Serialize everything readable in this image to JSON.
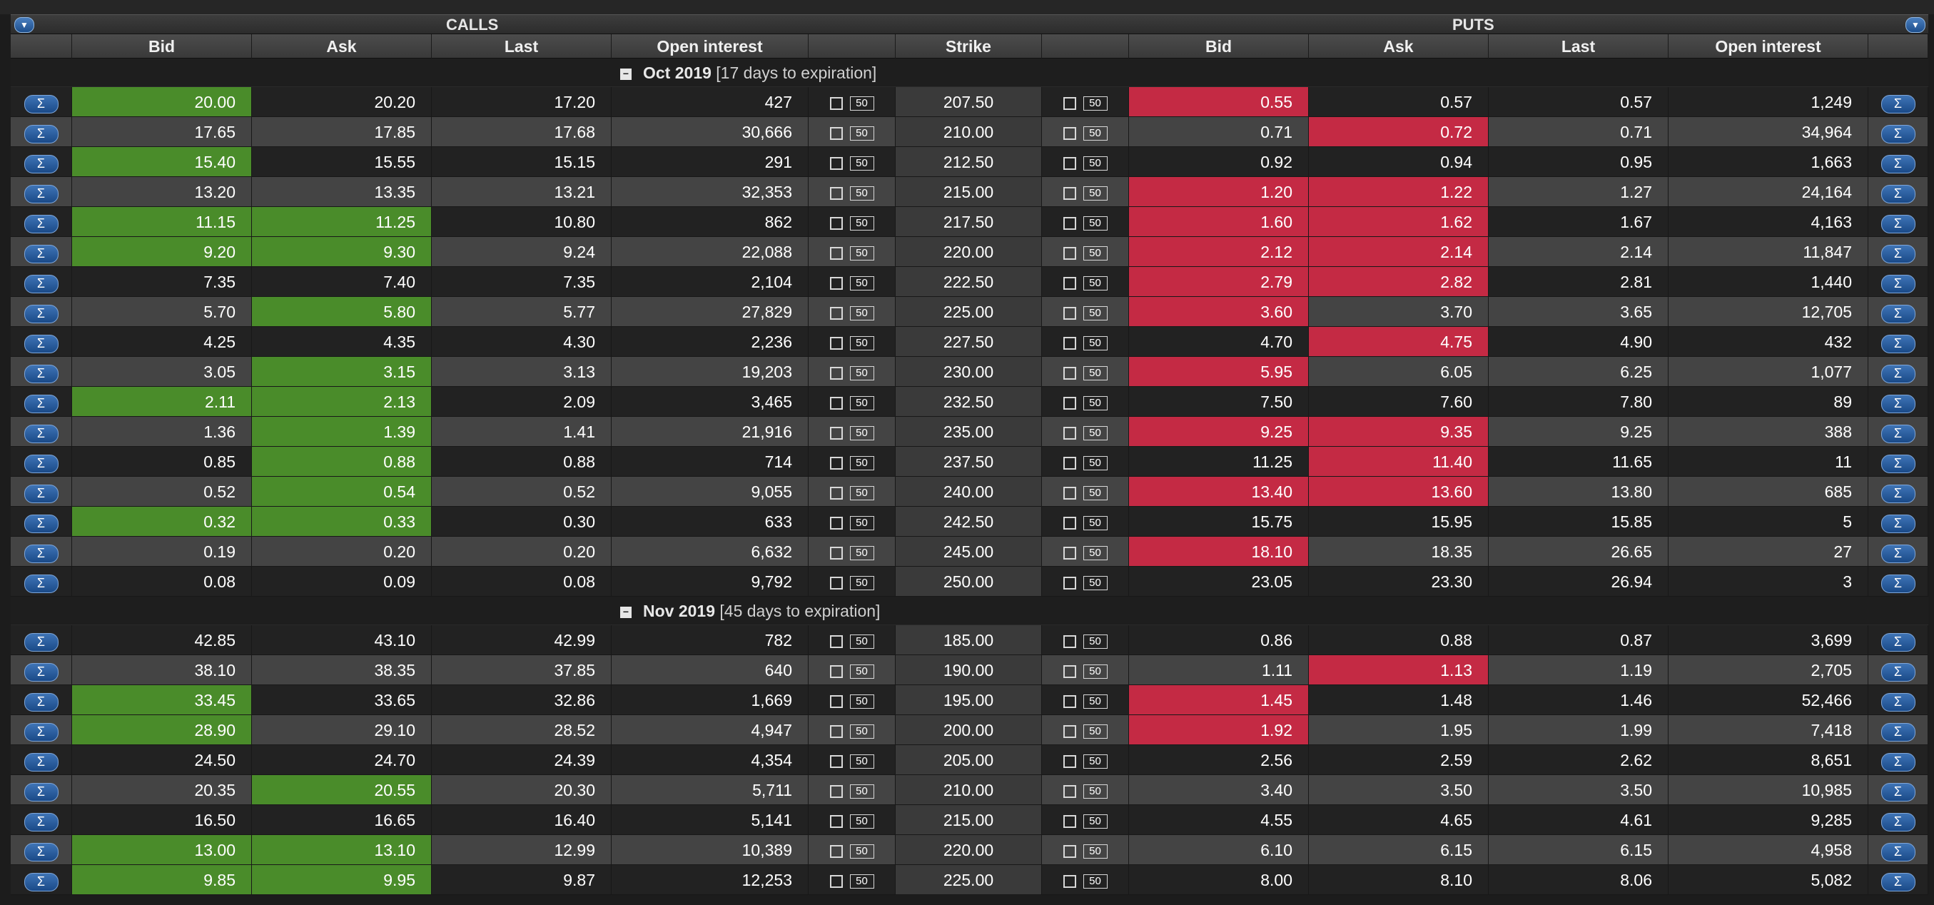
{
  "header": {
    "calls_title": "CALLS",
    "puts_title": "PUTS"
  },
  "columns": {
    "calls": [
      "Bid",
      "Ask",
      "Last",
      "Open interest"
    ],
    "strike": "Strike",
    "puts": [
      "Bid",
      "Ask",
      "Last",
      "Open interest"
    ]
  },
  "icons": {
    "sigma": "Σ",
    "menu": "▼",
    "collapse": "−"
  },
  "colors": {
    "bid_ask_up": "#4a8c2a",
    "bid_ask_down": "#c42a44",
    "strike_bg": "#3a3a3a"
  },
  "groups": [
    {
      "month": "Oct 2019",
      "days_label": "[17 days to expiration]",
      "rows": [
        {
          "cb": "20.00",
          "ca": "20.20",
          "cl": "17.20",
          "coi": "427",
          "cq": "50",
          "strike": "207.50",
          "pq": "50",
          "pb": "0.55",
          "pa": "0.57",
          "pl": "0.57",
          "poi": "1,249",
          "cbh": "g",
          "cah": "",
          "pbh": "r",
          "pah": ""
        },
        {
          "cb": "17.65",
          "ca": "17.85",
          "cl": "17.68",
          "coi": "30,666",
          "cq": "50",
          "strike": "210.00",
          "pq": "50",
          "pb": "0.71",
          "pa": "0.72",
          "pl": "0.71",
          "poi": "34,964",
          "cbh": "",
          "cah": "",
          "pbh": "",
          "pah": "r"
        },
        {
          "cb": "15.40",
          "ca": "15.55",
          "cl": "15.15",
          "coi": "291",
          "cq": "50",
          "strike": "212.50",
          "pq": "50",
          "pb": "0.92",
          "pa": "0.94",
          "pl": "0.95",
          "poi": "1,663",
          "cbh": "g",
          "cah": "",
          "pbh": "",
          "pah": ""
        },
        {
          "cb": "13.20",
          "ca": "13.35",
          "cl": "13.21",
          "coi": "32,353",
          "cq": "50",
          "strike": "215.00",
          "pq": "50",
          "pb": "1.20",
          "pa": "1.22",
          "pl": "1.27",
          "poi": "24,164",
          "cbh": "",
          "cah": "",
          "pbh": "r",
          "pah": "r"
        },
        {
          "cb": "11.15",
          "ca": "11.25",
          "cl": "10.80",
          "coi": "862",
          "cq": "50",
          "strike": "217.50",
          "pq": "50",
          "pb": "1.60",
          "pa": "1.62",
          "pl": "1.67",
          "poi": "4,163",
          "cbh": "g",
          "cah": "g",
          "pbh": "r",
          "pah": "r"
        },
        {
          "cb": "9.20",
          "ca": "9.30",
          "cl": "9.24",
          "coi": "22,088",
          "cq": "50",
          "strike": "220.00",
          "pq": "50",
          "pb": "2.12",
          "pa": "2.14",
          "pl": "2.14",
          "poi": "11,847",
          "cbh": "g",
          "cah": "g",
          "pbh": "r",
          "pah": "r"
        },
        {
          "cb": "7.35",
          "ca": "7.40",
          "cl": "7.35",
          "coi": "2,104",
          "cq": "50",
          "strike": "222.50",
          "pq": "50",
          "pb": "2.79",
          "pa": "2.82",
          "pl": "2.81",
          "poi": "1,440",
          "cbh": "",
          "cah": "",
          "pbh": "r",
          "pah": "r"
        },
        {
          "cb": "5.70",
          "ca": "5.80",
          "cl": "5.77",
          "coi": "27,829",
          "cq": "50",
          "strike": "225.00",
          "pq": "50",
          "pb": "3.60",
          "pa": "3.70",
          "pl": "3.65",
          "poi": "12,705",
          "cbh": "",
          "cah": "g",
          "pbh": "r",
          "pah": ""
        },
        {
          "cb": "4.25",
          "ca": "4.35",
          "cl": "4.30",
          "coi": "2,236",
          "cq": "50",
          "strike": "227.50",
          "pq": "50",
          "pb": "4.70",
          "pa": "4.75",
          "pl": "4.90",
          "poi": "432",
          "cbh": "",
          "cah": "",
          "pbh": "",
          "pah": "r"
        },
        {
          "cb": "3.05",
          "ca": "3.15",
          "cl": "3.13",
          "coi": "19,203",
          "cq": "50",
          "strike": "230.00",
          "pq": "50",
          "pb": "5.95",
          "pa": "6.05",
          "pl": "6.25",
          "poi": "1,077",
          "cbh": "",
          "cah": "g",
          "pbh": "r",
          "pah": ""
        },
        {
          "cb": "2.11",
          "ca": "2.13",
          "cl": "2.09",
          "coi": "3,465",
          "cq": "50",
          "strike": "232.50",
          "pq": "50",
          "pb": "7.50",
          "pa": "7.60",
          "pl": "7.80",
          "poi": "89",
          "cbh": "g",
          "cah": "g",
          "pbh": "",
          "pah": ""
        },
        {
          "cb": "1.36",
          "ca": "1.39",
          "cl": "1.41",
          "coi": "21,916",
          "cq": "50",
          "strike": "235.00",
          "pq": "50",
          "pb": "9.25",
          "pa": "9.35",
          "pl": "9.25",
          "poi": "388",
          "cbh": "",
          "cah": "g",
          "pbh": "r",
          "pah": "r"
        },
        {
          "cb": "0.85",
          "ca": "0.88",
          "cl": "0.88",
          "coi": "714",
          "cq": "50",
          "strike": "237.50",
          "pq": "50",
          "pb": "11.25",
          "pa": "11.40",
          "pl": "11.65",
          "poi": "11",
          "cbh": "",
          "cah": "g",
          "pbh": "",
          "pah": "r"
        },
        {
          "cb": "0.52",
          "ca": "0.54",
          "cl": "0.52",
          "coi": "9,055",
          "cq": "50",
          "strike": "240.00",
          "pq": "50",
          "pb": "13.40",
          "pa": "13.60",
          "pl": "13.80",
          "poi": "685",
          "cbh": "",
          "cah": "g",
          "pbh": "r",
          "pah": "r"
        },
        {
          "cb": "0.32",
          "ca": "0.33",
          "cl": "0.30",
          "coi": "633",
          "cq": "50",
          "strike": "242.50",
          "pq": "50",
          "pb": "15.75",
          "pa": "15.95",
          "pl": "15.85",
          "poi": "5",
          "cbh": "g",
          "cah": "g",
          "pbh": "",
          "pah": ""
        },
        {
          "cb": "0.19",
          "ca": "0.20",
          "cl": "0.20",
          "coi": "6,632",
          "cq": "50",
          "strike": "245.00",
          "pq": "50",
          "pb": "18.10",
          "pa": "18.35",
          "pl": "26.65",
          "poi": "27",
          "cbh": "",
          "cah": "",
          "pbh": "r",
          "pah": ""
        },
        {
          "cb": "0.08",
          "ca": "0.09",
          "cl": "0.08",
          "coi": "9,792",
          "cq": "50",
          "strike": "250.00",
          "pq": "50",
          "pb": "23.05",
          "pa": "23.30",
          "pl": "26.94",
          "poi": "3",
          "cbh": "",
          "cah": "",
          "pbh": "",
          "pah": ""
        }
      ]
    },
    {
      "month": "Nov 2019",
      "days_label": "[45 days to expiration]",
      "rows": [
        {
          "cb": "42.85",
          "ca": "43.10",
          "cl": "42.99",
          "coi": "782",
          "cq": "50",
          "strike": "185.00",
          "pq": "50",
          "pb": "0.86",
          "pa": "0.88",
          "pl": "0.87",
          "poi": "3,699",
          "cbh": "",
          "cah": "",
          "pbh": "",
          "pah": ""
        },
        {
          "cb": "38.10",
          "ca": "38.35",
          "cl": "37.85",
          "coi": "640",
          "cq": "50",
          "strike": "190.00",
          "pq": "50",
          "pb": "1.11",
          "pa": "1.13",
          "pl": "1.19",
          "poi": "2,705",
          "cbh": "",
          "cah": "",
          "pbh": "",
          "pah": "r"
        },
        {
          "cb": "33.45",
          "ca": "33.65",
          "cl": "32.86",
          "coi": "1,669",
          "cq": "50",
          "strike": "195.00",
          "pq": "50",
          "pb": "1.45",
          "pa": "1.48",
          "pl": "1.46",
          "poi": "52,466",
          "cbh": "g",
          "cah": "",
          "pbh": "r",
          "pah": ""
        },
        {
          "cb": "28.90",
          "ca": "29.10",
          "cl": "28.52",
          "coi": "4,947",
          "cq": "50",
          "strike": "200.00",
          "pq": "50",
          "pb": "1.92",
          "pa": "1.95",
          "pl": "1.99",
          "poi": "7,418",
          "cbh": "g",
          "cah": "",
          "pbh": "r",
          "pah": ""
        },
        {
          "cb": "24.50",
          "ca": "24.70",
          "cl": "24.39",
          "coi": "4,354",
          "cq": "50",
          "strike": "205.00",
          "pq": "50",
          "pb": "2.56",
          "pa": "2.59",
          "pl": "2.62",
          "poi": "8,651",
          "cbh": "",
          "cah": "",
          "pbh": "",
          "pah": ""
        },
        {
          "cb": "20.35",
          "ca": "20.55",
          "cl": "20.30",
          "coi": "5,711",
          "cq": "50",
          "strike": "210.00",
          "pq": "50",
          "pb": "3.40",
          "pa": "3.50",
          "pl": "3.50",
          "poi": "10,985",
          "cbh": "",
          "cah": "g",
          "pbh": "",
          "pah": ""
        },
        {
          "cb": "16.50",
          "ca": "16.65",
          "cl": "16.40",
          "coi": "5,141",
          "cq": "50",
          "strike": "215.00",
          "pq": "50",
          "pb": "4.55",
          "pa": "4.65",
          "pl": "4.61",
          "poi": "9,285",
          "cbh": "",
          "cah": "",
          "pbh": "",
          "pah": ""
        },
        {
          "cb": "13.00",
          "ca": "13.10",
          "cl": "12.99",
          "coi": "10,389",
          "cq": "50",
          "strike": "220.00",
          "pq": "50",
          "pb": "6.10",
          "pa": "6.15",
          "pl": "6.15",
          "poi": "4,958",
          "cbh": "g",
          "cah": "g",
          "pbh": "",
          "pah": ""
        },
        {
          "cb": "9.85",
          "ca": "9.95",
          "cl": "9.87",
          "coi": "12,253",
          "cq": "50",
          "strike": "225.00",
          "pq": "50",
          "pb": "8.00",
          "pa": "8.10",
          "pl": "8.06",
          "poi": "5,082",
          "cbh": "g",
          "cah": "g",
          "pbh": "",
          "pah": ""
        }
      ]
    }
  ]
}
